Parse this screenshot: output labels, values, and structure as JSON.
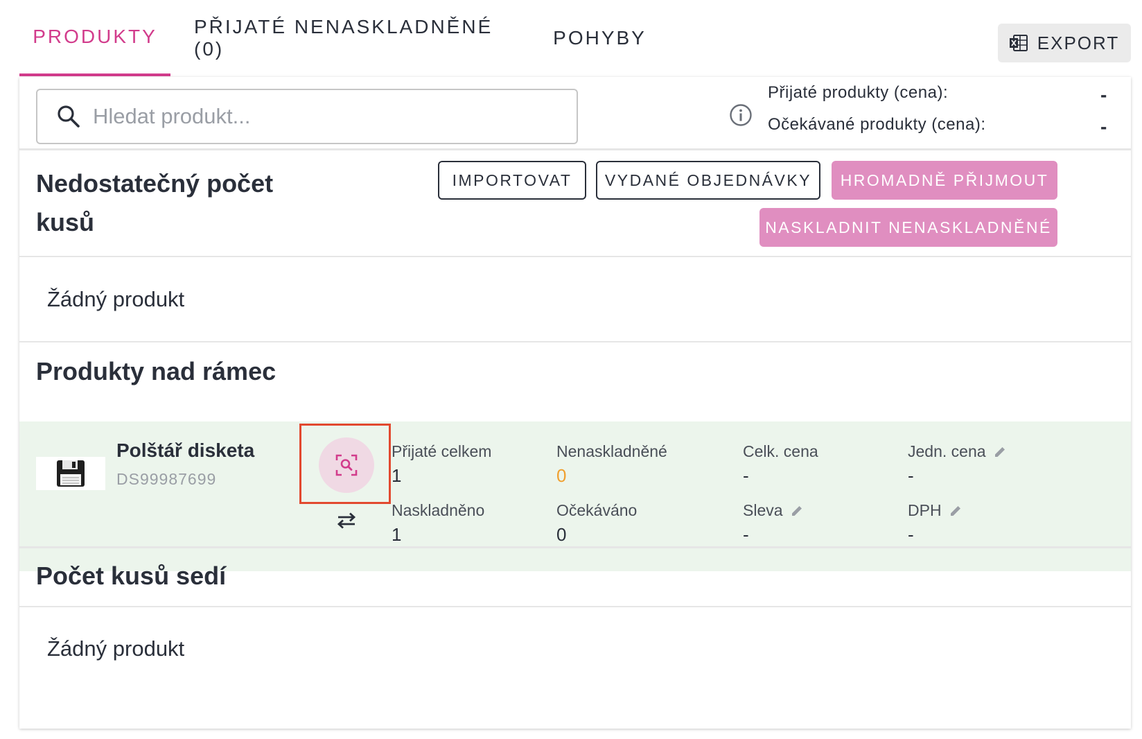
{
  "tabs": [
    {
      "label": "PRODUKTY"
    },
    {
      "label": "PŘIJATÉ NENASKLADNĚNÉ (0)"
    },
    {
      "label": "POHYBY"
    }
  ],
  "export": {
    "label": "EXPORT",
    "icon": "excel-icon"
  },
  "search": {
    "placeholder": "Hledat produkt...",
    "value": ""
  },
  "summary": {
    "received_label": "Přijaté produkty (cena):",
    "received_value": "-",
    "expected_label": "Očekávané produkty (cena):",
    "expected_value": "-"
  },
  "sections": {
    "insufficient": {
      "title": "Nedostatečný počet kusů",
      "empty": "Žádný produkt"
    },
    "over": {
      "title": "Produkty nad rámec"
    },
    "matching": {
      "title": "Počet kusů sedí",
      "empty": "Žádný produkt"
    }
  },
  "actions": {
    "import": "IMPORTOVAT",
    "issued_orders": "VYDANÉ OBJEDNÁVKY",
    "bulk_receive": "HROMADNĚ PŘIJMOUT",
    "stock_unstocked": "NASKLADNIT NENASKLADNĚNÉ"
  },
  "product": {
    "name": "Polštář disketa",
    "code": "DS99987699",
    "fields": {
      "received_total": {
        "label": "Přijaté celkem",
        "value": "1"
      },
      "unstocked": {
        "label": "Nenaskladněné",
        "value": "0"
      },
      "total_price": {
        "label": "Celk. cena",
        "value": "-"
      },
      "unit_price": {
        "label": "Jedn. cena",
        "value": "-"
      },
      "stocked": {
        "label": "Naskladněno",
        "value": "1"
      },
      "expected": {
        "label": "Očekáváno",
        "value": "0"
      },
      "discount": {
        "label": "Sleva",
        "value": "-"
      },
      "vat": {
        "label": "DPH",
        "value": "-"
      }
    }
  },
  "colors": {
    "accent": "#d23c8c",
    "pink_button": "#e08ec0",
    "row_bg": "#ecf5ec",
    "highlight": "#e2492f",
    "warning": "#f0a030"
  }
}
